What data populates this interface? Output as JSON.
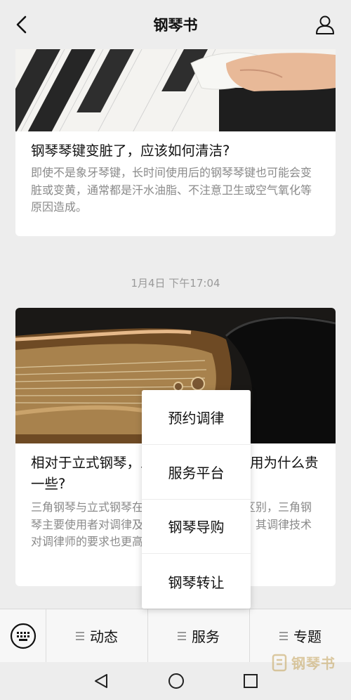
{
  "header": {
    "title": "钢琴书"
  },
  "articles": [
    {
      "title": "钢琴琴键变脏了，应该如何清洁?",
      "desc": "即使不是象牙琴键，长时间使用后的钢琴琴键也可能会变脏或变黄，通常都是汗水油脂、不注意卫生或空气氧化等原因造成。"
    },
    {
      "timestamp": "1月4日 下午17:04",
      "title": "相对于立式钢琴，三角钢琴的调律费用为什么贵一些?",
      "desc": "三角钢琴与立式钢琴在机械结构上存在明显区别，三角钢琴主要使用者对调律及音准音质的要求更高，其调律技术对调律师的要求也更高。"
    }
  ],
  "popup_menu": [
    "预约调律",
    "服务平台",
    "钢琴导购",
    "钢琴转让"
  ],
  "bottom_menu": [
    "动态",
    "服务",
    "专题"
  ],
  "watermark": {
    "text": "钢琴书"
  },
  "icons": {
    "back": "back-arrow-icon",
    "user": "user-icon",
    "keyboard": "keyboard-icon",
    "menu": "menu-lines-icon",
    "nav_back": "triangle-back-icon",
    "nav_home": "circle-home-icon",
    "nav_recent": "square-recent-icon"
  },
  "colors": {
    "background": "#ededed",
    "card": "#ffffff",
    "desc_text": "#8a8a8a",
    "watermark": "#c5a35a"
  }
}
